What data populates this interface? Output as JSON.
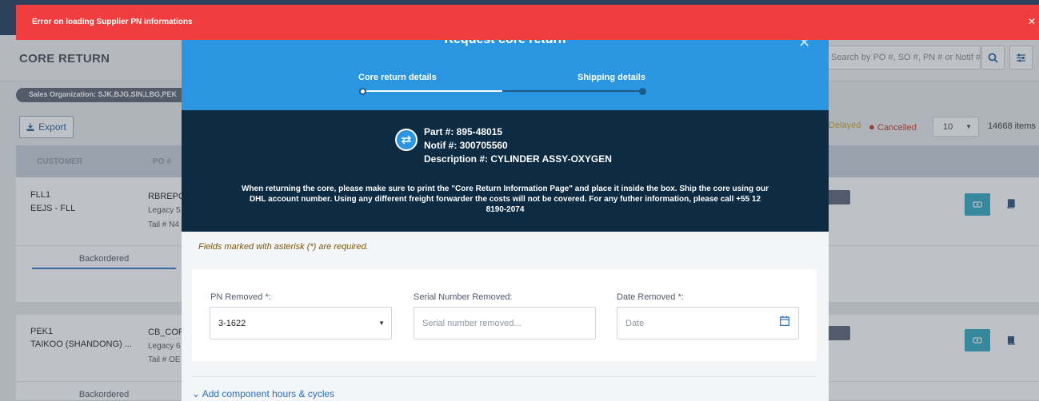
{
  "page": {
    "title": "CORE RETURN",
    "search_placeholder": "Search by PO #, SO #, PN # or Notif #",
    "sales_org_chip": "Sales Organization: SJK,BJG,SIN,LBG,PEK",
    "export_label": "Export",
    "legend": {
      "delayed": "Delayed",
      "cancelled": "Cancelled"
    },
    "page_size": "10",
    "items_count": "14668 items",
    "columns": [
      "CUSTOMER",
      "PO #"
    ],
    "rows": [
      {
        "customer_code": "FLL1",
        "customer_name": "EEJS - FLL",
        "po": "RBREPC",
        "legacy": "Legacy 5",
        "tail": "Tail # N4",
        "tab": "Backordered"
      },
      {
        "customer_code": "PEK1",
        "customer_name": "TAIKOO (SHANDONG) ...",
        "po": "CB_COR",
        "legacy": "Legacy 6",
        "tail": "Tail # OE",
        "tab": "Backordered"
      }
    ]
  },
  "modal": {
    "title": "Request core return",
    "steps": [
      {
        "label": "Core return details",
        "active": true
      },
      {
        "label": "Shipping details",
        "active": false
      }
    ],
    "info": {
      "part": "Part #: 895-48015",
      "notif": "Notif #: 300705560",
      "description": "Description #: CYLINDER ASSY-OXYGEN",
      "note": "When returning the core, please make sure to print the \"Core Return Information Page\" and place it inside the box. Ship the core using our DHL account number. Using any different freight forwarder the costs will not be covered. For any futher information, please call +55 12 8190-2074"
    },
    "required_note": "Fields marked with asterisk (*) are required.",
    "fields": {
      "pn_removed": {
        "label": "PN Removed",
        "asterisk": "*:",
        "value": "3-1622"
      },
      "serial_removed": {
        "label": "Serial Number Removed:",
        "placeholder": "Serial number removed..."
      },
      "date_removed": {
        "label": "Date Removed",
        "asterisk": "*:",
        "placeholder": "Date"
      }
    },
    "add_component_link": "Add component hours & cycles"
  },
  "toast": {
    "message": "Error on loading Supplier PN informations",
    "color": "#f03e3e"
  },
  "colors": {
    "primary": "#2a95e1",
    "dark_panel": "#0d2c44",
    "teal": "#2fa8c0"
  }
}
